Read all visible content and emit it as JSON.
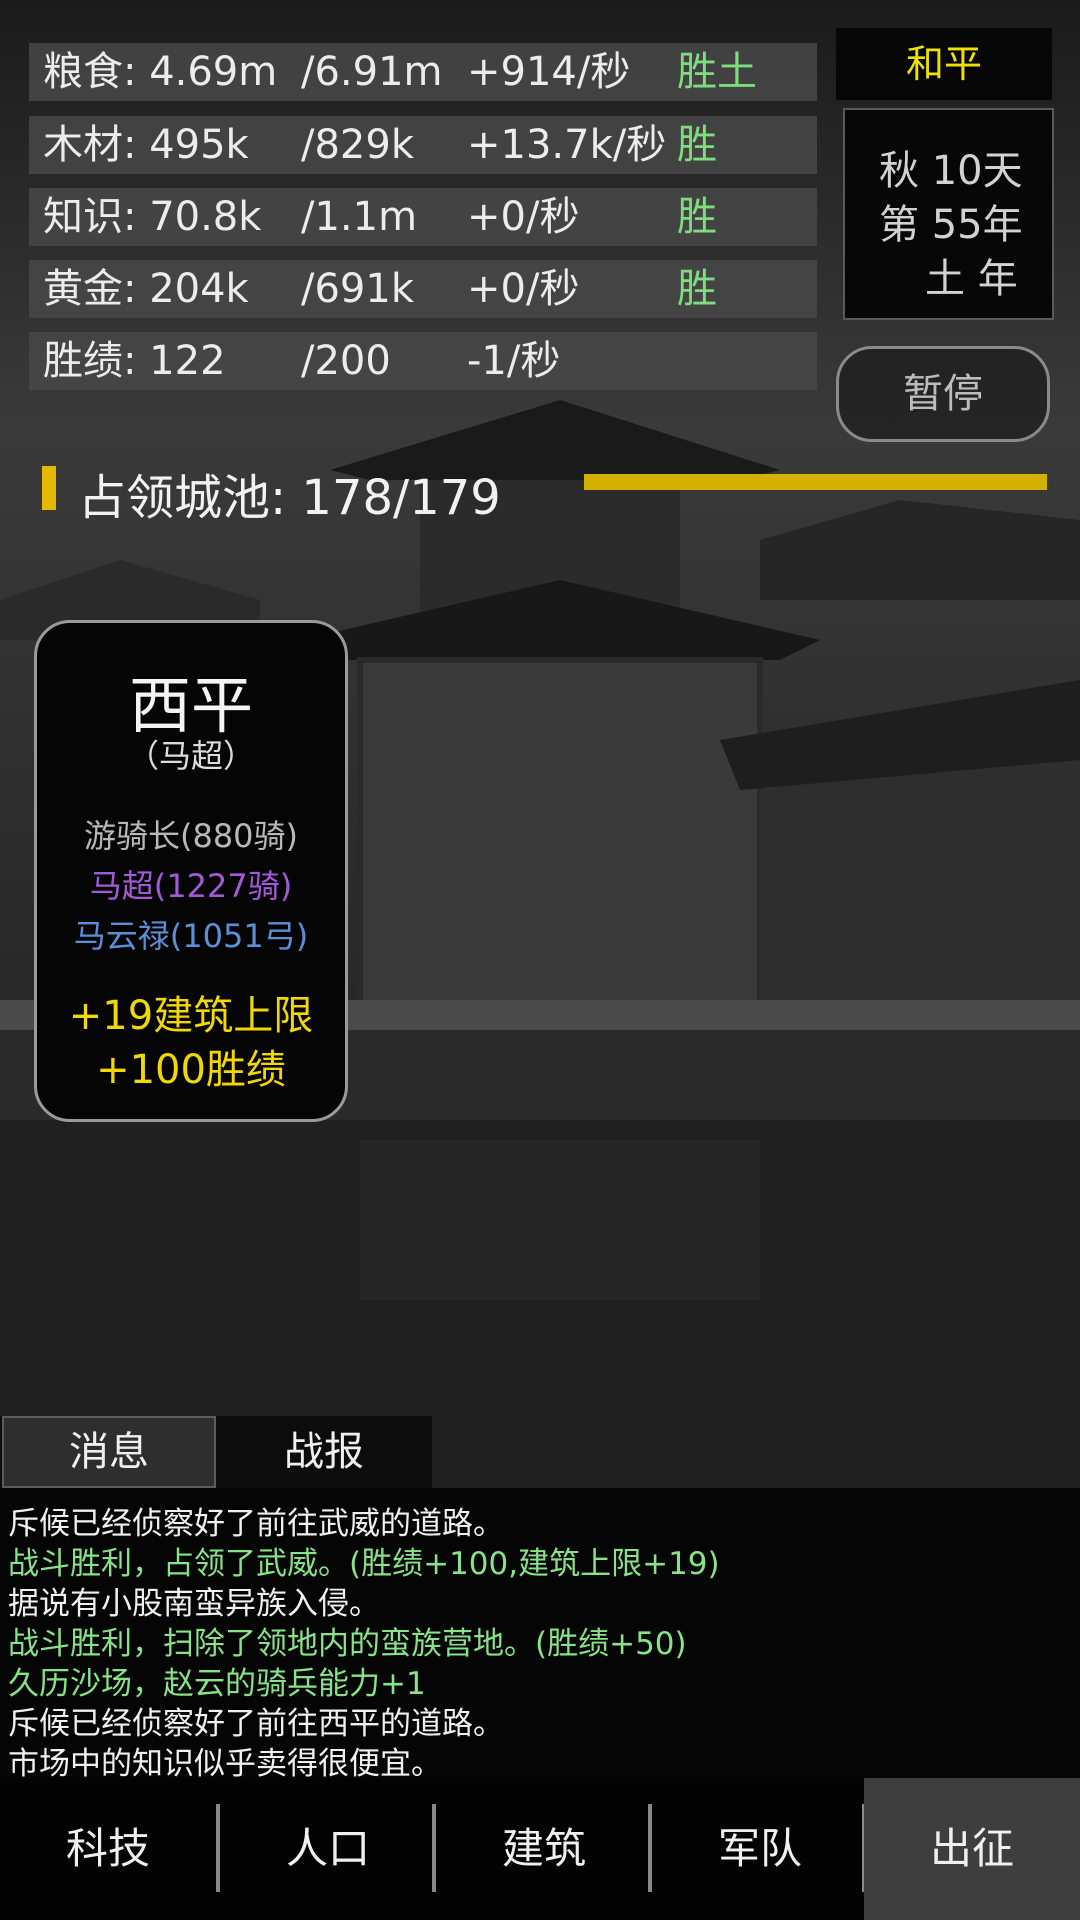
{
  "resources": [
    {
      "name": "粮食: 4.69m",
      "max": "/6.91m",
      "rate": "+914/秒",
      "status": "胜土"
    },
    {
      "name": "木材: 495k",
      "max": "/829k",
      "rate": "+13.7k/秒",
      "status": "胜"
    },
    {
      "name": "知识: 70.8k",
      "max": "/1.1m",
      "rate": "+0/秒",
      "status": "胜"
    },
    {
      "name": "黄金: 204k",
      "max": "/691k",
      "rate": "+0/秒",
      "status": "胜"
    },
    {
      "name": "胜绩: 122",
      "max": "/200",
      "rate": "-1/秒",
      "status": ""
    }
  ],
  "status_panel": {
    "peace": "和平",
    "date_line1": "秋 10天",
    "date_line2": "第 55年",
    "date_line3": "土 年",
    "pause_label": "暂停"
  },
  "occupation": {
    "text": "占领城池: 178/179",
    "progress": 0.994
  },
  "city": {
    "name": "西平",
    "lord": "（马超）",
    "units": [
      "游骑长(880骑)",
      "马超(1227骑)",
      "马云禄(1051弓)"
    ],
    "bonuses": [
      "+19建筑上限",
      "+100胜绩"
    ]
  },
  "tabs": {
    "messages": "消息",
    "battle": "战报"
  },
  "log": [
    {
      "text": "斥候已经侦察好了前往武威的道路。",
      "color": "#f0f0f0"
    },
    {
      "text": "战斗胜利，占领了武威。(胜绩+100,建筑上限+19)",
      "color": "#86e486"
    },
    {
      "text": "据说有小股南蛮异族入侵。",
      "color": "#f0f0f0"
    },
    {
      "text": "战斗胜利，扫除了领地内的蛮族营地。(胜绩+50)",
      "color": "#86e486"
    },
    {
      "text": "久历沙场，赵云的骑兵能力+1",
      "color": "#86e486"
    },
    {
      "text": "斥候已经侦察好了前往西平的道路。",
      "color": "#f0f0f0"
    },
    {
      "text": "市场中的知识似乎卖得很便宜。",
      "color": "#f0f0f0"
    }
  ],
  "nav": [
    "科技",
    "人口",
    "建筑",
    "军队",
    "出征"
  ],
  "colors": {
    "accent_yellow": "#f0e000",
    "positive_green": "#86e486",
    "progress_gold": "#d4b100"
  }
}
